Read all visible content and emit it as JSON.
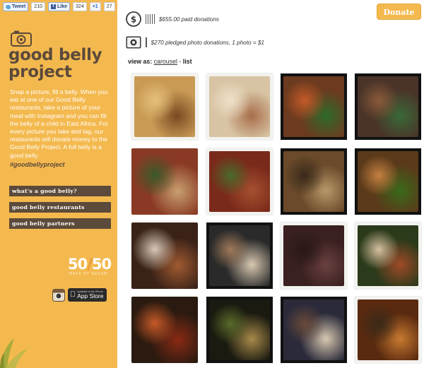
{
  "social": {
    "tweet_label": "Tweet",
    "tweet_count": "210",
    "like_label": "Like",
    "like_count": "324",
    "plusone_label": "+1",
    "plusone_count": "27"
  },
  "brand": {
    "title": "good belly project",
    "intro": "Snap a picture, fill a belly. When you eat at one of our Good Belly restaurants, take a picture of your meal with Instagram and you can fill the belly of a child in East Africa. For every picture you take and tag, our restaurants will donate money to the Good Belly Project. A full belly is a good belly.",
    "hashtag": "#goodbellyproject"
  },
  "nav": {
    "items": [
      {
        "label": "what's a good belly?"
      },
      {
        "label": "good belly restaurants"
      },
      {
        "label": "good belly partners"
      }
    ]
  },
  "partner": {
    "logo_num_left": "50",
    "logo_num_right": "50",
    "logo_tagline": "MAKE OF AKSAM",
    "appstore_small": "Available on the iPhone",
    "appstore_label": "App Store"
  },
  "header": {
    "donate_label": "Donate",
    "paid_donations": "$655.00 paid donations",
    "pledged_donations": "$270 pledged photo donations, 1 photo = $1"
  },
  "view": {
    "prefix": "view as:",
    "carousel_label": "carousel",
    "separator": "-",
    "list_label": "list"
  },
  "photos": [
    {
      "desc": "pizza with olives",
      "frame": "polaroid",
      "colors": [
        "#c89a55",
        "#7a4a22",
        "#e5c07a"
      ]
    },
    {
      "desc": "cheese flatbread",
      "frame": "polaroid",
      "colors": [
        "#d8c4a4",
        "#a86e4a",
        "#efe0c8"
      ]
    },
    {
      "desc": "noodle bowl with vegetables",
      "frame": "dark",
      "colors": [
        "#6c3b1f",
        "#2e6a2a",
        "#c45a28"
      ]
    },
    {
      "desc": "stir fry with greens",
      "frame": "dark",
      "colors": [
        "#4a3428",
        "#3a6a38",
        "#8a5a3a"
      ]
    },
    {
      "desc": "meat and noodle plate",
      "frame": "plain",
      "colors": [
        "#8a3a24",
        "#c8a070",
        "#3a5a2a"
      ]
    },
    {
      "desc": "salad with meat",
      "frame": "polaroid",
      "colors": [
        "#7a2a1a",
        "#a65030",
        "#4a6a2a"
      ]
    },
    {
      "desc": "pad thai",
      "frame": "dark",
      "colors": [
        "#6a4a2a",
        "#b89868",
        "#3a2a1a"
      ]
    },
    {
      "desc": "noodles with peppers",
      "frame": "dark",
      "colors": [
        "#5a3a1a",
        "#3a6a1a",
        "#c48040"
      ]
    },
    {
      "desc": "iced tea drink",
      "frame": "plain",
      "colors": [
        "#3a2218",
        "#a05a30",
        "#d8c8b8"
      ]
    },
    {
      "desc": "sliced meat plate",
      "frame": "dark",
      "colors": [
        "#2a2a2a",
        "#d8c8b0",
        "#a07a5a"
      ]
    },
    {
      "desc": "dim restaurant table",
      "frame": "polaroid",
      "colors": [
        "#3a2020",
        "#6a4040",
        "#2a1818"
      ]
    },
    {
      "desc": "dessert with berries",
      "frame": "polaroid",
      "colors": [
        "#2a3a1a",
        "#a04a28",
        "#d8c0a0"
      ]
    },
    {
      "desc": "tomato soup",
      "frame": "plain",
      "colors": [
        "#2a1a10",
        "#8a2a14",
        "#c85a28"
      ]
    },
    {
      "desc": "dinner plate with sauces",
      "frame": "dark",
      "colors": [
        "#1a1a10",
        "#a88a4a",
        "#5a6a2a"
      ]
    },
    {
      "desc": "plate with puree",
      "frame": "dark",
      "colors": [
        "#2a2a3a",
        "#d8c8b0",
        "#6a4a3a"
      ]
    },
    {
      "desc": "grilled meat dish",
      "frame": "polaroid",
      "colors": [
        "#5a2a10",
        "#c87a30",
        "#3a2a18"
      ]
    }
  ]
}
